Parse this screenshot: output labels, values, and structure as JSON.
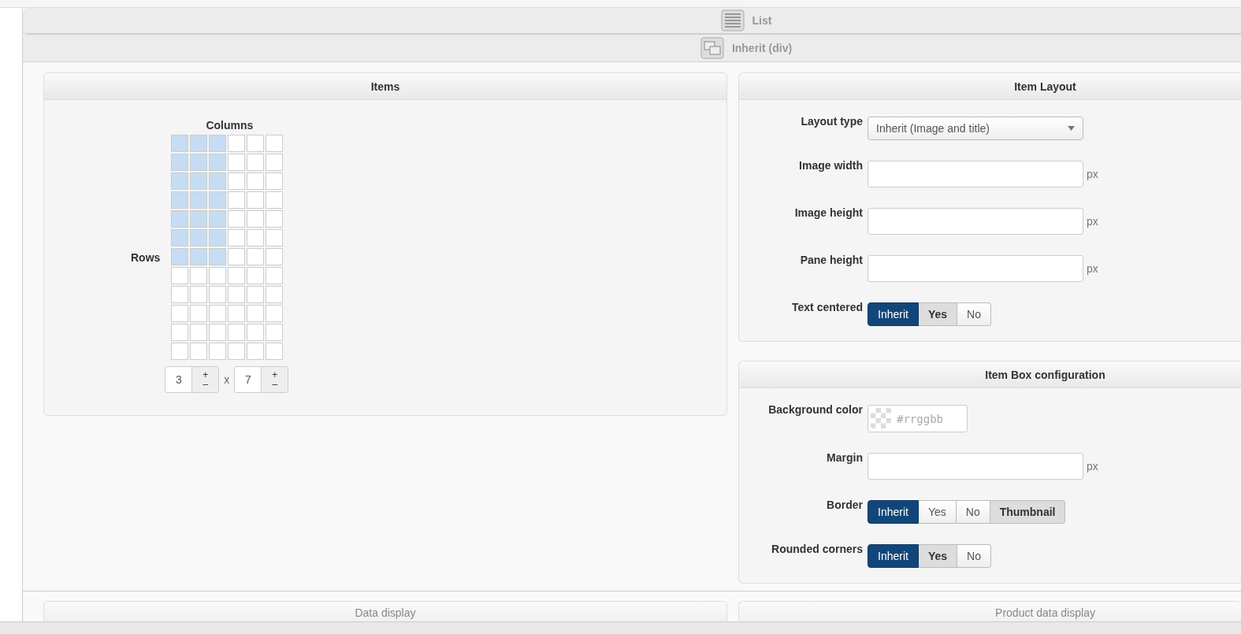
{
  "sections": [
    {
      "kind": "list",
      "label": "List"
    },
    {
      "kind": "div",
      "label": "Inherit (div)"
    }
  ],
  "items": {
    "title": "Items",
    "columns_label": "Columns",
    "rows_label": "Rows",
    "grid": [
      {
        "cells": [
          true,
          true,
          true,
          false,
          false,
          false
        ]
      },
      {
        "cells": [
          true,
          true,
          true,
          false,
          false,
          false
        ]
      },
      {
        "cells": [
          true,
          true,
          true,
          false,
          false,
          false
        ]
      },
      {
        "cells": [
          true,
          true,
          true,
          false,
          false,
          false
        ]
      },
      {
        "cells": [
          true,
          true,
          true,
          false,
          false,
          false
        ]
      },
      {
        "cells": [
          true,
          true,
          true,
          false,
          false,
          false
        ]
      },
      {
        "cells": [
          true,
          true,
          true,
          false,
          false,
          false
        ]
      },
      {
        "cells": [
          false,
          false,
          false,
          false,
          false,
          false
        ]
      },
      {
        "cells": [
          false,
          false,
          false,
          false,
          false,
          false
        ]
      },
      {
        "cells": [
          false,
          false,
          false,
          false,
          false,
          false
        ]
      },
      {
        "cells": [
          false,
          false,
          false,
          false,
          false,
          false
        ]
      },
      {
        "cells": [
          false,
          false,
          false,
          false,
          false,
          false
        ]
      }
    ],
    "columns_value": "3",
    "separator": "x",
    "rows_value": "7",
    "plus": "+",
    "minus": "–"
  },
  "panels": [
    {
      "title": "Item Layout",
      "fields": [
        {
          "kind": "select",
          "label": "Layout type",
          "value": "Inherit (Image and title)"
        },
        {
          "kind": "input",
          "label": "Image width",
          "unit": "px"
        },
        {
          "kind": "input",
          "label": "Image height",
          "unit": "px"
        },
        {
          "kind": "input",
          "label": "Pane height",
          "unit": "px"
        },
        {
          "kind": "segmented",
          "label": "Text centered",
          "options": [
            {
              "label": "Inherit",
              "selected": true,
              "inherited": false
            },
            {
              "label": "Yes",
              "selected": false,
              "inherited": true
            },
            {
              "label": "No",
              "selected": false,
              "inherited": false
            }
          ]
        }
      ]
    },
    {
      "title": "Item Box configuration",
      "fields": [
        {
          "kind": "color",
          "label": "Background color",
          "placeholder": "#rrggbb"
        },
        {
          "kind": "input",
          "label": "Margin",
          "unit": "px"
        },
        {
          "kind": "segmented",
          "label": "Border",
          "options": [
            {
              "label": "Inherit",
              "selected": true,
              "inherited": false
            },
            {
              "label": "Yes",
              "selected": false,
              "inherited": false
            },
            {
              "label": "No",
              "selected": false,
              "inherited": false
            },
            {
              "label": "Thumbnail",
              "selected": false,
              "inherited": true
            }
          ]
        },
        {
          "kind": "segmented",
          "label": "Rounded corners",
          "options": [
            {
              "label": "Inherit",
              "selected": true,
              "inherited": false
            },
            {
              "label": "Yes",
              "selected": false,
              "inherited": true
            },
            {
              "label": "No",
              "selected": false,
              "inherited": false
            }
          ]
        }
      ]
    }
  ],
  "bottom_panels": [
    {
      "title": "Data display"
    },
    {
      "title": "Product data display"
    }
  ]
}
